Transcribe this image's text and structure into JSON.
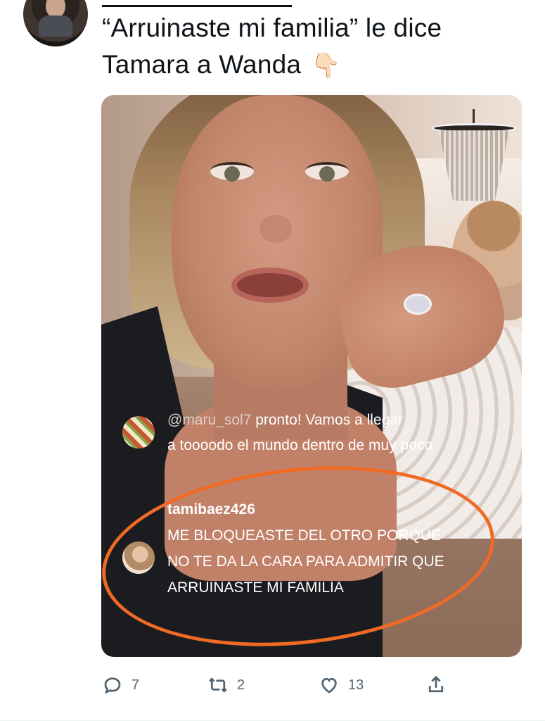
{
  "tweet": {
    "text_line1": "“Arruinaste mi familia” le dice",
    "text_line2": "Tamara a Wanda",
    "emoji": "👇🏻"
  },
  "media": {
    "comments": [
      {
        "user": "@maru_sol7",
        "text_inline": " pronto! Vamos a llegar",
        "text_rest": "a toooodo el mundo dentro de muy poco"
      },
      {
        "user": "tamibaez426",
        "text": "ME BLOQUEASTE DEL OTRO PORQUE NO TE DA LA CARA PARA ADMITIR QUE ARRUINASTE MI FAMILIA"
      }
    ],
    "annotation_color": "#f06a24"
  },
  "actions": {
    "replies": "7",
    "retweets": "2",
    "likes": "13"
  },
  "icons": [
    "reply-icon",
    "retweet-icon",
    "like-icon",
    "share-icon",
    "pointing-down-emoji"
  ]
}
